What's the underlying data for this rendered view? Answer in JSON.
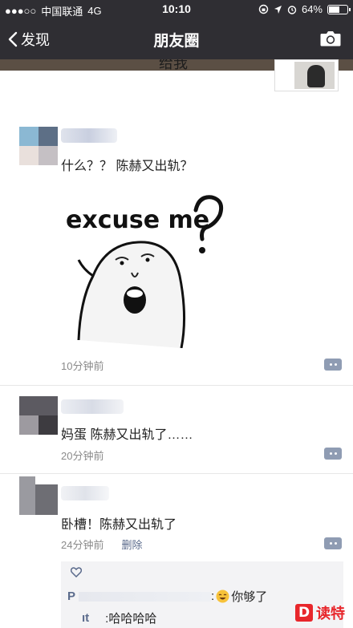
{
  "status": {
    "signal": "●●●○○",
    "carrier": "中国联通",
    "network": "4G",
    "time": "10:10",
    "battery_percent": "64%",
    "battery_level": 0.64
  },
  "nav": {
    "back_label": "发现",
    "title": "朋友圈"
  },
  "cover": {
    "partial_text": "给我"
  },
  "comments": [
    {
      "text": "什么？？ 陈赫又出轨？",
      "time": "10分钟前",
      "sticker_text": "excuse me"
    },
    {
      "text": "妈蛋  陈赫又出轨了……",
      "time": "20分钟前"
    },
    {
      "text": "卧槽！陈赫又出轨了",
      "time": "24分钟前",
      "delete_label": "删除"
    }
  ],
  "panel": {
    "row1_prefix": "P",
    "row1_text": ":",
    "row1_reply": "你够了",
    "row2_prefix": "ıt",
    "row2_reply": ":哈哈哈哈"
  },
  "watermark": {
    "logo": "D",
    "text": "读特"
  },
  "colors": {
    "header_bg": "#2f2e33",
    "link_blue": "#5b6b8c",
    "watermark_red": "#e8262b"
  }
}
